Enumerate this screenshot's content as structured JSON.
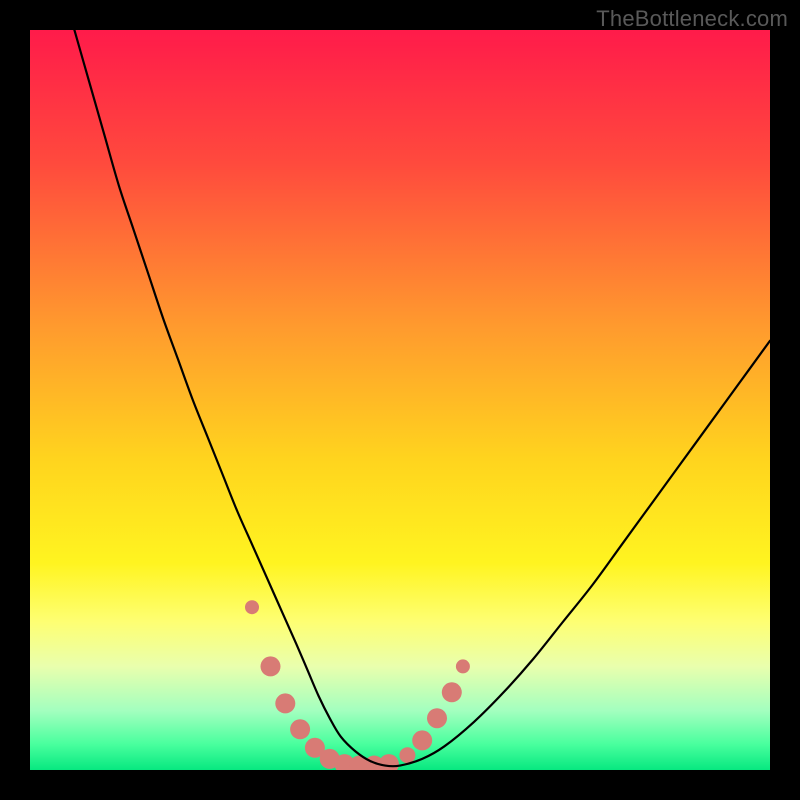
{
  "watermark": "TheBottleneck.com",
  "chart_data": {
    "type": "line",
    "title": "",
    "xlabel": "",
    "ylabel": "",
    "xlim": [
      0,
      100
    ],
    "ylim": [
      0,
      100
    ],
    "grid": false,
    "legend": false,
    "gradient_stops": [
      {
        "offset": 0.0,
        "color": "#ff1b4a"
      },
      {
        "offset": 0.18,
        "color": "#ff4a3d"
      },
      {
        "offset": 0.4,
        "color": "#ff9a2e"
      },
      {
        "offset": 0.58,
        "color": "#ffd41e"
      },
      {
        "offset": 0.72,
        "color": "#fff420"
      },
      {
        "offset": 0.8,
        "color": "#feff73"
      },
      {
        "offset": 0.86,
        "color": "#e9ffad"
      },
      {
        "offset": 0.92,
        "color": "#a3ffbf"
      },
      {
        "offset": 0.965,
        "color": "#49ff9e"
      },
      {
        "offset": 1.0,
        "color": "#07e880"
      }
    ],
    "series": [
      {
        "name": "bottleneck-curve",
        "color": "#000000",
        "x": [
          6,
          8,
          10,
          12,
          14,
          16,
          18,
          20,
          22,
          24,
          26,
          28,
          30,
          32,
          34,
          36,
          37.5,
          39,
          40.5,
          42,
          44,
          46,
          48,
          50,
          53,
          56,
          60,
          64,
          68,
          72,
          76,
          80,
          84,
          88,
          92,
          96,
          100
        ],
        "values": [
          100,
          93,
          86,
          79,
          73,
          67,
          61,
          55.5,
          50,
          45,
          40,
          35,
          30.5,
          26,
          21.5,
          17,
          13.5,
          10,
          7,
          4.5,
          2.5,
          1.2,
          0.6,
          0.6,
          1.5,
          3.2,
          6.5,
          10.5,
          15,
          20,
          25,
          30.5,
          36,
          41.5,
          47,
          52.5,
          58
        ]
      }
    ],
    "markers": {
      "name": "highlight-dots",
      "color": "#d87b75",
      "points": [
        {
          "x": 30.0,
          "y": 22.0,
          "r": 7
        },
        {
          "x": 32.5,
          "y": 14.0,
          "r": 10
        },
        {
          "x": 34.5,
          "y": 9.0,
          "r": 10
        },
        {
          "x": 36.5,
          "y": 5.5,
          "r": 10
        },
        {
          "x": 38.5,
          "y": 3.0,
          "r": 10
        },
        {
          "x": 40.5,
          "y": 1.5,
          "r": 10
        },
        {
          "x": 42.5,
          "y": 0.8,
          "r": 10
        },
        {
          "x": 44.5,
          "y": 0.6,
          "r": 10
        },
        {
          "x": 46.5,
          "y": 0.6,
          "r": 10
        },
        {
          "x": 48.5,
          "y": 0.8,
          "r": 10
        },
        {
          "x": 51.0,
          "y": 2.0,
          "r": 8
        },
        {
          "x": 53.0,
          "y": 4.0,
          "r": 10
        },
        {
          "x": 55.0,
          "y": 7.0,
          "r": 10
        },
        {
          "x": 57.0,
          "y": 10.5,
          "r": 10
        },
        {
          "x": 58.5,
          "y": 14.0,
          "r": 7
        }
      ]
    }
  }
}
